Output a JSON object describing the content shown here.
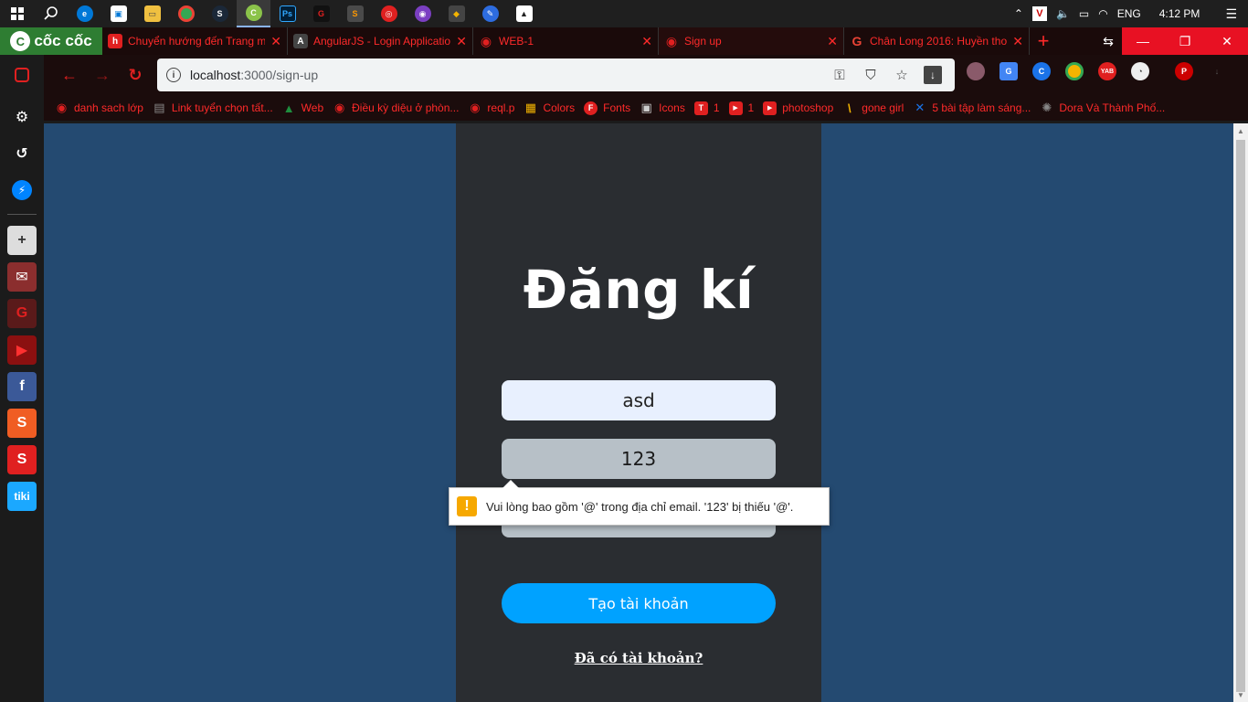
{
  "taskbar": {
    "language": "ENG",
    "time": "4:12 PM"
  },
  "browser": {
    "brand": "cốc cốc",
    "tabs": [
      {
        "title": "Chuyển hướng đến Trang m",
        "favicon": "h",
        "color": "#e02020"
      },
      {
        "title": "AngularJS - Login Applicatio",
        "favicon": "A",
        "color": "#444444"
      },
      {
        "title": "WEB-1",
        "favicon": "◉",
        "color": "#e02020"
      },
      {
        "title": "Sign up",
        "favicon": "◉",
        "color": "#e02020"
      },
      {
        "title": "Chân Long 2016: Huyền tho",
        "favicon": "G",
        "color": "#ea4335"
      }
    ],
    "url_host": "localhost",
    "url_path": ":3000/sign-up",
    "bookmarks": [
      {
        "label": "danh sach lớp",
        "icon": "◉",
        "color": "#e02020"
      },
      {
        "label": "Link tuyển chọn tất...",
        "icon": "▤",
        "color": "#444444"
      },
      {
        "label": "Web",
        "icon": "▲",
        "color": "#1e8e3e"
      },
      {
        "label": "Điều kỳ diệu ở phòn...",
        "icon": "◉",
        "color": "#e02020"
      },
      {
        "label": "reql.p",
        "icon": "◉",
        "color": "#e02020"
      },
      {
        "label": "Colors",
        "icon": "▦",
        "color": "#f4b400"
      },
      {
        "label": "Fonts",
        "icon": "F",
        "color": "#e02020"
      },
      {
        "label": "Icons",
        "icon": "▣",
        "color": "#888888"
      },
      {
        "label": "1",
        "icon": "T",
        "color": "#e02020"
      },
      {
        "label": "1",
        "icon": "▶",
        "color": "#e02020"
      },
      {
        "label": "photoshop",
        "icon": "▶",
        "color": "#e02020"
      },
      {
        "label": "gone girl",
        "icon": "\\",
        "color": "#f4b400"
      },
      {
        "label": "5 bài tập làm sáng...",
        "icon": "✕",
        "color": "#1a73e8"
      },
      {
        "label": "Dora Và Thành Phố...",
        "icon": "✺",
        "color": "#555555"
      }
    ]
  },
  "page": {
    "title": "Đăng kí",
    "username_value": "asd",
    "email_value": "123",
    "password_value": "",
    "submit_label": "Tạo tài khoản",
    "login_link": "Đã có tài khoản?",
    "validation_message": "Vui lòng bao gồm '@' trong địa chỉ email. '123' bị thiếu '@'."
  },
  "colors": {
    "page_bg": "#244a71",
    "card_bg": "#2a2d31",
    "button": "#00a2ff",
    "accent_red": "#ff2a2a"
  }
}
